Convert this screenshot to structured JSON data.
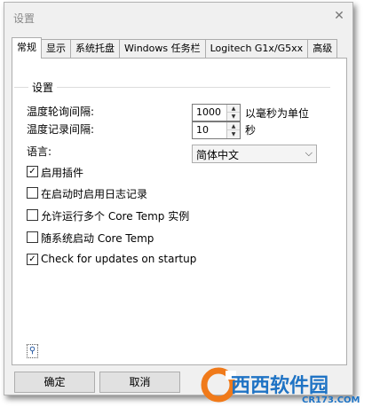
{
  "window": {
    "title": "设置",
    "close_glyph": "✕"
  },
  "tabs": [
    {
      "label": "常规",
      "active": true
    },
    {
      "label": "显示",
      "active": false
    },
    {
      "label": "系统托盘",
      "active": false
    },
    {
      "label": "Windows 任务栏",
      "active": false
    },
    {
      "label": "Logitech G1x/G5xx",
      "active": false
    },
    {
      "label": "高级",
      "active": false
    }
  ],
  "general": {
    "group_title": "设置",
    "poll_interval": {
      "label": "温度轮询间隔:",
      "value": "1000",
      "unit": "以毫秒为单位"
    },
    "log_interval": {
      "label": "温度记录间隔:",
      "value": "10",
      "unit": "秒"
    },
    "language": {
      "label": "语言:",
      "value": "简体中文"
    },
    "checkboxes": [
      {
        "label": "启用插件",
        "checked": true
      },
      {
        "label": "在启动时启用日志记录",
        "checked": false
      },
      {
        "label": "允许运行多个 Core Temp 实例",
        "checked": false
      },
      {
        "label": "随系统启动 Core Temp",
        "checked": false
      },
      {
        "label": "Check for updates on startup",
        "checked": true
      }
    ]
  },
  "buttons": {
    "ok": "确定",
    "cancel": "取消"
  },
  "watermark": {
    "brand": "西西软件园",
    "url": "CR173.COM"
  },
  "colors": {
    "watermark_orange": "#f07a1a",
    "watermark_blue": "#1f73c4"
  }
}
